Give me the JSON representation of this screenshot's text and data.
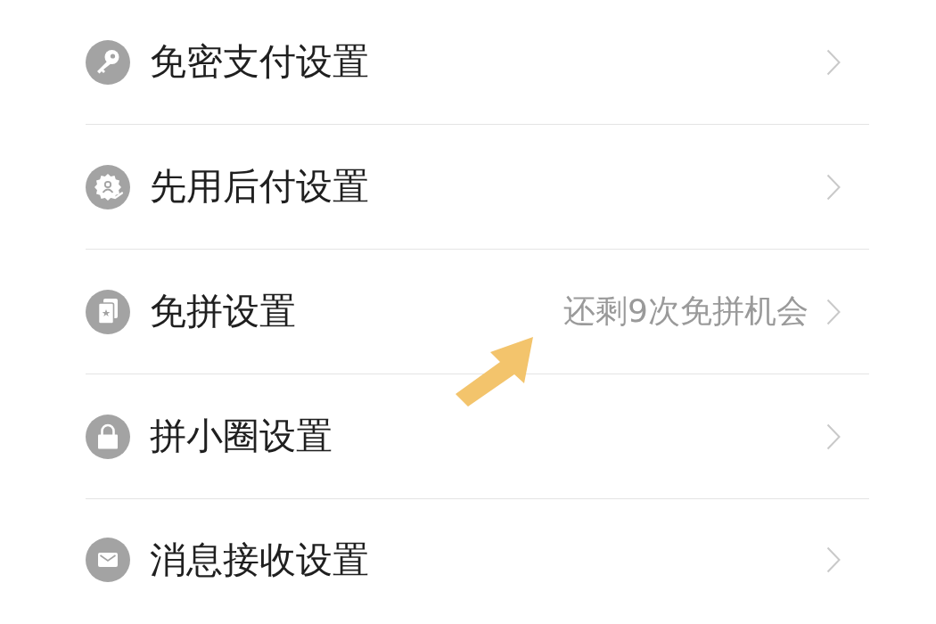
{
  "settings": [
    {
      "label": "免密支付设置"
    },
    {
      "label": "先用后付设置"
    },
    {
      "label": "免拼设置",
      "hint": "还剩9次免拼机会"
    },
    {
      "label": "拼小圈设置"
    },
    {
      "label": "消息接收设置"
    }
  ]
}
